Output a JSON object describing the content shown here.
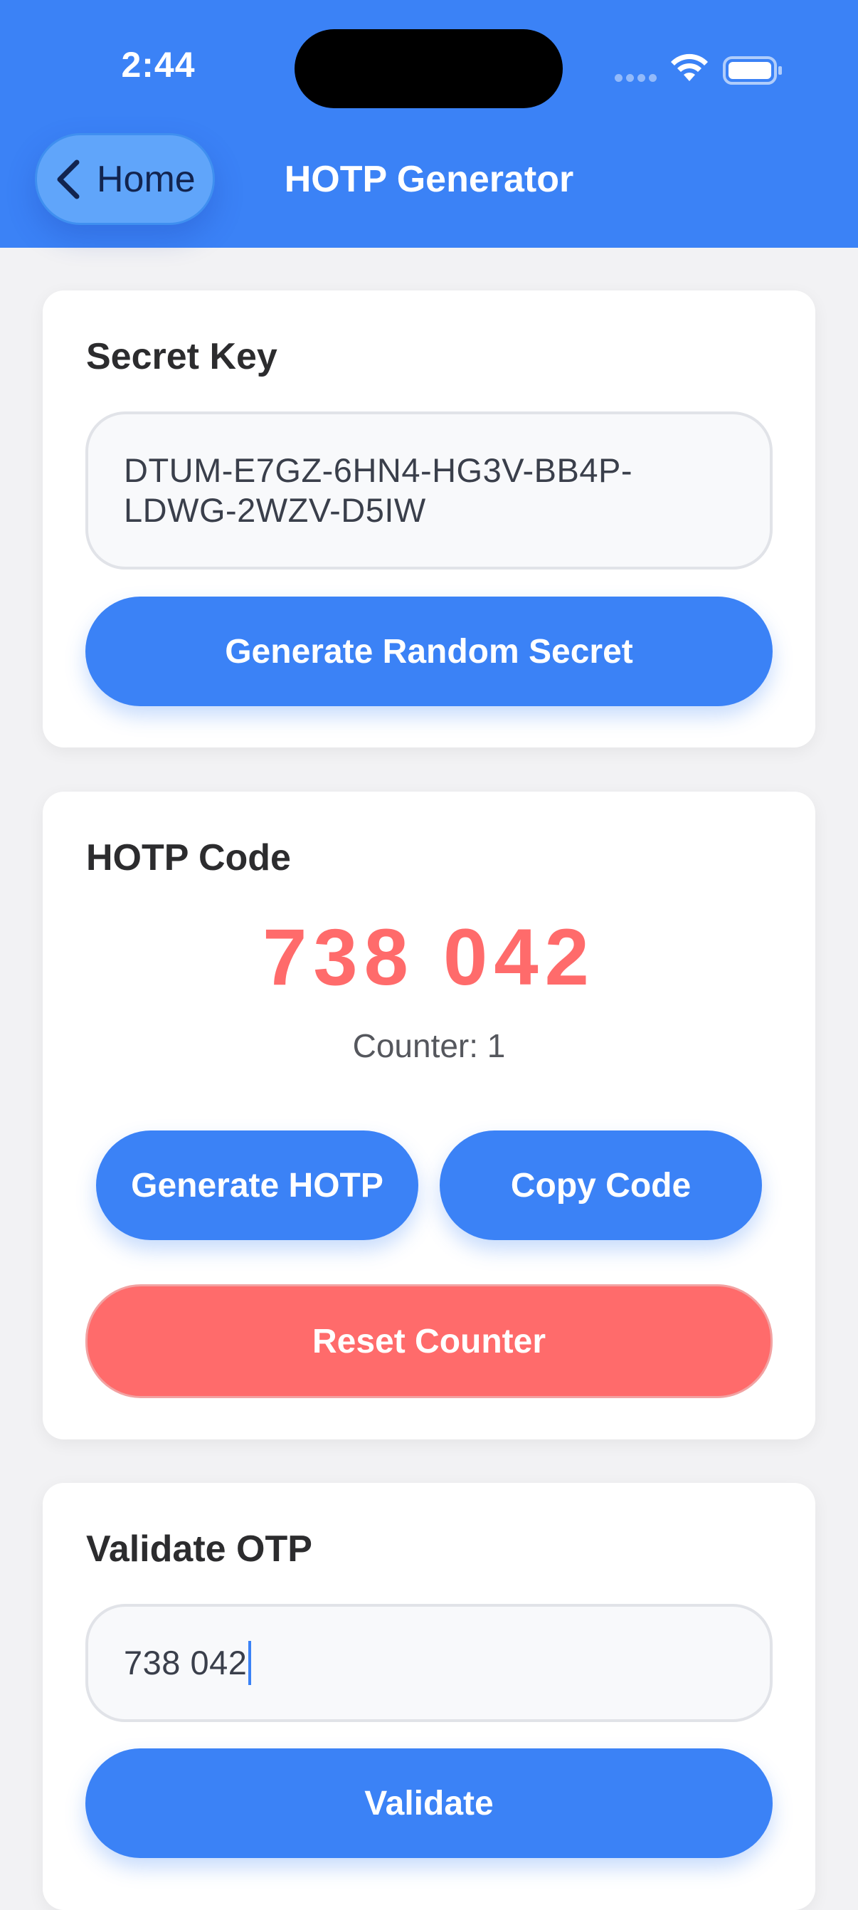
{
  "status_bar": {
    "time": "2:44"
  },
  "nav": {
    "back_label": "Home",
    "title": "HOTP Generator"
  },
  "secret_section": {
    "title": "Secret Key",
    "secret_line1": "DTUM-E7GZ-6HN4-HG3V-BB4P-",
    "secret_line2": "LDWG-2WZV-D5IW",
    "generate_button": "Generate Random Secret"
  },
  "hotp_section": {
    "title": "HOTP Code",
    "code": "738 042",
    "counter_label": "Counter: 1",
    "generate_button": "Generate HOTP",
    "copy_button": "Copy Code",
    "reset_button": "Reset Counter"
  },
  "validate_section": {
    "title": "Validate OTP",
    "input_value": "738 042",
    "validate_button": "Validate"
  },
  "colors": {
    "accent": "#3b82f6",
    "danger": "#ff6b6b",
    "background": "#f2f2f4"
  },
  "icons": {
    "back": "chevron-left-icon",
    "wifi": "wifi-icon",
    "battery": "battery-icon",
    "signal": "cellular-signal-icon"
  }
}
